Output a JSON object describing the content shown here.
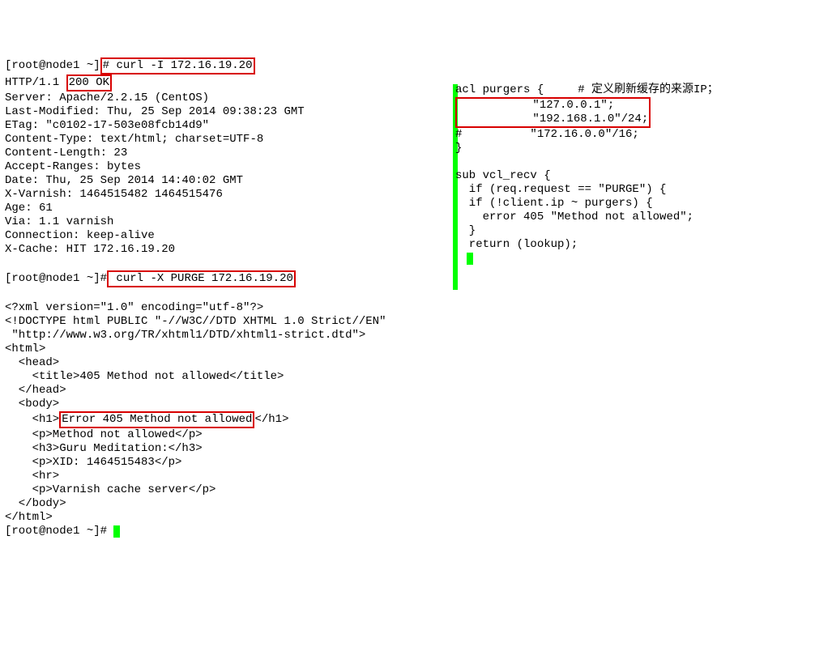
{
  "left": {
    "prompt1_pre": "[root@node1 ~]",
    "prompt1_hash": "#",
    "cmd1": "curl -I 172.16.19.20",
    "http_prefix": "HTTP/1.1",
    "http_status": "200 OK",
    "headers": [
      "Server: Apache/2.2.15 (CentOS)",
      "Last-Modified: Thu, 25 Sep 2014 09:38:23 GMT",
      "ETag: \"c0102-17-503e08fcb14d9\"",
      "Content-Type: text/html; charset=UTF-8",
      "Content-Length: 23",
      "Accept-Ranges: bytes",
      "Date: Thu, 25 Sep 2014 14:40:02 GMT",
      "X-Varnish: 1464515482 1464515476",
      "Age: 61",
      "Via: 1.1 varnish",
      "Connection: keep-alive",
      "X-Cache: HIT 172.16.19.20"
    ],
    "prompt2": "[root@node1 ~]#",
    "cmd2": " curl -X PURGE 172.16.19.20",
    "xml_decl": "<?xml version=\"1.0\" encoding=\"utf-8\"?>",
    "doctype1": "<!DOCTYPE html PUBLIC \"-//W3C//DTD XHTML 1.0 Strict//EN\"",
    "doctype2": " \"http://www.w3.org/TR/xhtml1/DTD/xhtml1-strict.dtd\">",
    "html_open": "<html>",
    "head_open": "  <head>",
    "title_line": "    <title>405 Method not allowed</title>",
    "head_close": "  </head>",
    "body_open": "  <body>",
    "h1_pre": "    <h1>",
    "h1_text": "Error 405 Method not allowed",
    "h1_post": "</h1>",
    "p_method": "    <p>Method not allowed</p>",
    "h3_guru": "    <h3>Guru Meditation:</h3>",
    "p_xid": "    <p>XID: 1464515483</p>",
    "hr_line": "    <hr>",
    "p_varnish": "    <p>Varnish cache server</p>",
    "body_close": "  </body>",
    "html_close": "</html>",
    "prompt3": "[root@node1 ~]# "
  },
  "right": {
    "acl_line": "acl purgers {     # 定义刷新缓存的来源IP；",
    "box_line1": "           \"127.0.0.1\";",
    "box_line2": "           \"192.168.1.0\"/24;",
    "commented": "#          \"172.16.0.0\"/16;",
    "close_brace": "}",
    "sub_line": "sub vcl_recv {",
    "if_req": "  if (req.request == \"PURGE\") {",
    "if_client": "  if (!client.ip ~ purgers) {",
    "error_line": "    error 405 \"Method not allowed\";",
    "inner_close": "  }",
    "return_line": "  return (lookup);"
  }
}
